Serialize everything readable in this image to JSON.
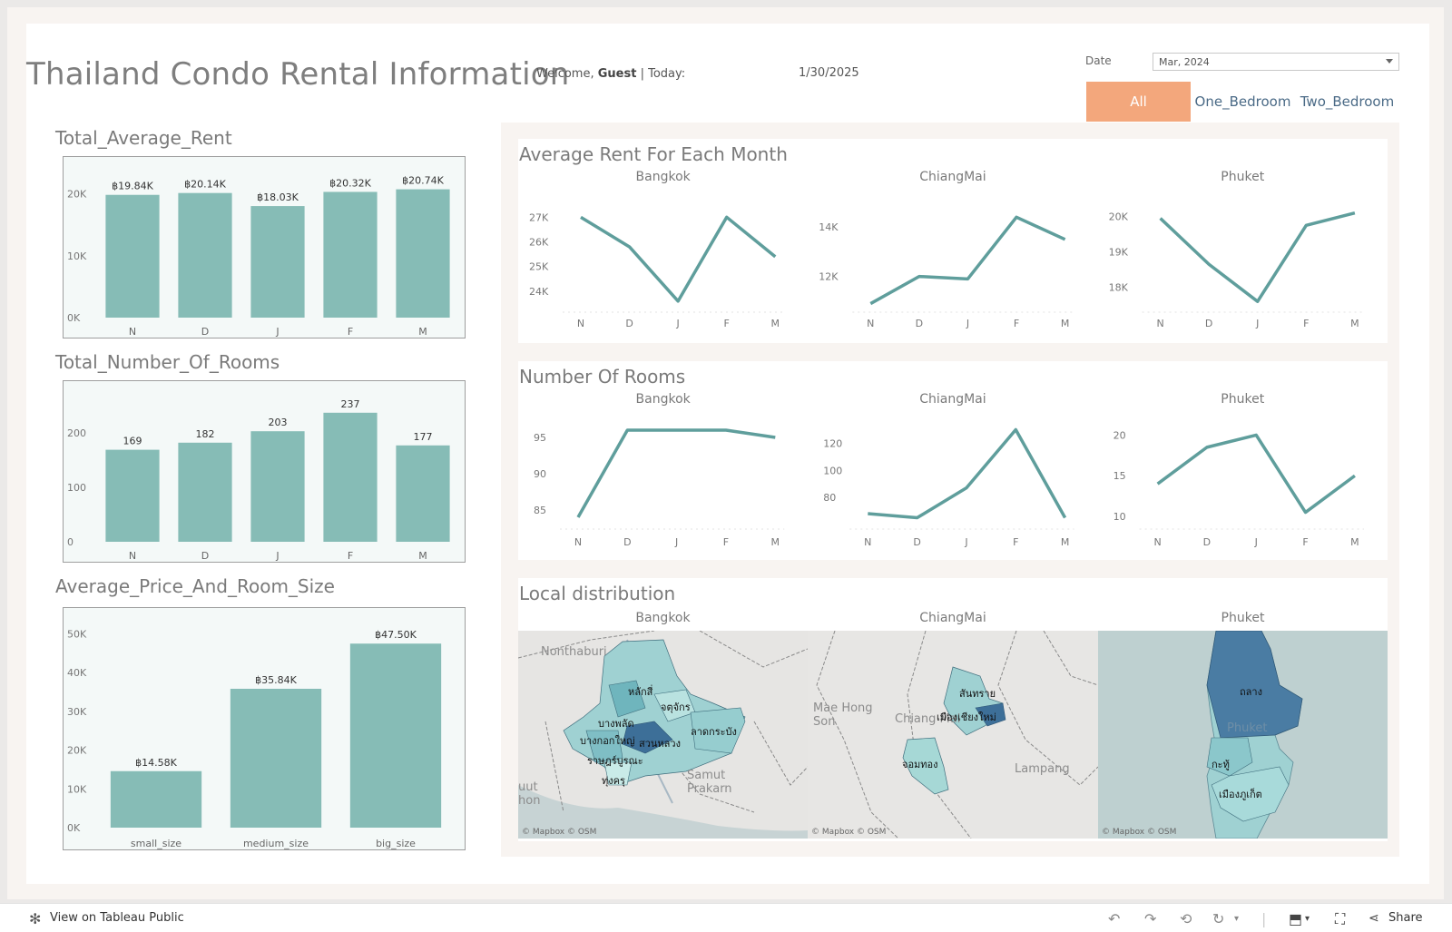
{
  "dashboard": {
    "title": "Thailand Condo Rental Information",
    "welcome_prefix": "Welcome,",
    "welcome_user": "Guest",
    "welcome_suffix": "| Today:",
    "today_value": "1/30/2025"
  },
  "filter": {
    "date_label": "Date",
    "date_value": "Mar, 2024",
    "room_buttons": [
      "All",
      "One_Bedroom",
      "Two_Bedroom"
    ],
    "selected": "All",
    "selected_color": "#f3a77c"
  },
  "colors": {
    "bar": "#86bcb6",
    "line": "#5f9e9c",
    "title": "#7a7a7a"
  },
  "left_charts": {
    "avg_rent_title": "Total_Average_Rent",
    "rooms_title": "Total_Number_Of_Rooms",
    "price_size_title": "Average_Price_And_Room_Size"
  },
  "right_sections": {
    "avg_rent_month_title": "Average Rent For Each Month",
    "rooms_title": "Number Of Rooms",
    "local_title": "Local distribution",
    "cities": [
      "Bangkok",
      "ChiangMai",
      "Phuket"
    ]
  },
  "maps": {
    "credit": "© Mapbox  © OSM",
    "bangkok_places": [
      "Nonthaburi",
      "Samut\nPrakarn",
      "uut\nhon"
    ],
    "bangkok_districts": [
      "หลักสี่",
      "จตุจักร",
      "บางพลัด",
      "ลาดกระบัง",
      "บางกอกใหญ่",
      "สวนหลวง",
      "ราษฎร์บูรณะ",
      "ทุ่งครุ"
    ],
    "chiangmai_places": [
      "Mae Hong\nSon",
      "Chiang Mai",
      "Lampang"
    ],
    "chiangmai_districts": [
      "สันทราย",
      "เมืองเชียงใหม่",
      "จอมทอง"
    ],
    "phuket_places": [
      "Phuket"
    ],
    "phuket_districts": [
      "ถลาง",
      "กะทู้",
      "เมืองภูเก็ต"
    ]
  },
  "footer": {
    "view_label": "View on Tableau Public",
    "share_label": "Share"
  },
  "chart_data": [
    {
      "id": "total_average_rent",
      "type": "bar",
      "title": "Total_Average_Rent",
      "categories": [
        "N",
        "D",
        "J",
        "F",
        "M"
      ],
      "values": [
        19840,
        20140,
        18030,
        20320,
        20740
      ],
      "data_labels": [
        "฿19.84K",
        "฿20.14K",
        "฿18.03K",
        "฿20.32K",
        "฿20.74K"
      ],
      "y_ticks": [
        "0K",
        "10K",
        "20K"
      ],
      "y_tick_values": [
        0,
        10000,
        20000
      ],
      "ylim": [
        0,
        22000
      ]
    },
    {
      "id": "total_number_of_rooms",
      "type": "bar",
      "title": "Total_Number_Of_Rooms",
      "categories": [
        "N",
        "D",
        "J",
        "F",
        "M"
      ],
      "values": [
        169,
        182,
        203,
        237,
        177
      ],
      "data_labels": [
        "169",
        "182",
        "203",
        "237",
        "177"
      ],
      "y_ticks": [
        "0",
        "100",
        "200"
      ],
      "y_tick_values": [
        0,
        100,
        200
      ],
      "ylim": [
        0,
        250
      ]
    },
    {
      "id": "average_price_and_room_size",
      "type": "bar",
      "title": "Average_Price_And_Room_Size",
      "categories": [
        "small_size",
        "medium_size",
        "big_size"
      ],
      "values": [
        14580,
        35840,
        47500
      ],
      "data_labels": [
        "฿14.58K",
        "฿35.84K",
        "฿47.50K"
      ],
      "y_ticks": [
        "0K",
        "10K",
        "20K",
        "30K",
        "40K",
        "50K"
      ],
      "y_tick_values": [
        0,
        10000,
        20000,
        30000,
        40000,
        50000
      ],
      "ylim": [
        0,
        52000
      ]
    },
    {
      "id": "avg_rent_bangkok",
      "type": "line",
      "title": "Bangkok",
      "x": [
        "N",
        "D",
        "J",
        "F",
        "M"
      ],
      "values": [
        27000,
        25800,
        23600,
        27000,
        25400
      ],
      "y_ticks": [
        "24K",
        "25K",
        "26K",
        "27K"
      ],
      "y_tick_values": [
        24000,
        25000,
        26000,
        27000
      ],
      "ylim": [
        23300,
        27600
      ]
    },
    {
      "id": "avg_rent_chiangmai",
      "type": "line",
      "title": "ChiangMai",
      "x": [
        "N",
        "D",
        "J",
        "F",
        "M"
      ],
      "values": [
        10900,
        12000,
        11900,
        14400,
        13500
      ],
      "y_ticks": [
        "12K",
        "14K"
      ],
      "y_tick_values": [
        12000,
        14000
      ],
      "ylim": [
        10700,
        15000
      ]
    },
    {
      "id": "avg_rent_phuket",
      "type": "line",
      "title": "Phuket",
      "x": [
        "N",
        "D",
        "J",
        "F",
        "M"
      ],
      "values": [
        19950,
        18650,
        17600,
        19750,
        20100
      ],
      "y_ticks": [
        "18K",
        "19K",
        "20K"
      ],
      "y_tick_values": [
        18000,
        19000,
        20000
      ],
      "ylim": [
        17400,
        20400
      ]
    },
    {
      "id": "rooms_bangkok",
      "type": "line",
      "title": "Bangkok",
      "x": [
        "N",
        "D",
        "J",
        "F",
        "M"
      ],
      "values": [
        84,
        96,
        96,
        96,
        95
      ],
      "y_ticks": [
        "85",
        "90",
        "95"
      ],
      "y_tick_values": [
        85,
        90,
        95
      ],
      "ylim": [
        83,
        97
      ]
    },
    {
      "id": "rooms_chiangmai",
      "type": "line",
      "title": "ChiangMai",
      "x": [
        "N",
        "D",
        "J",
        "F",
        "M"
      ],
      "values": [
        68,
        65,
        87,
        130,
        65
      ],
      "y_ticks": [
        "80",
        "100",
        "120"
      ],
      "y_tick_values": [
        80,
        100,
        120
      ],
      "ylim": [
        60,
        135
      ]
    },
    {
      "id": "rooms_phuket",
      "type": "line",
      "title": "Phuket",
      "x": [
        "N",
        "D",
        "J",
        "F",
        "M"
      ],
      "values": [
        14,
        18.5,
        20,
        10.5,
        15
      ],
      "y_ticks": [
        "10",
        "15",
        "20"
      ],
      "y_tick_values": [
        10,
        15,
        20
      ],
      "ylim": [
        9,
        21.5
      ]
    }
  ]
}
